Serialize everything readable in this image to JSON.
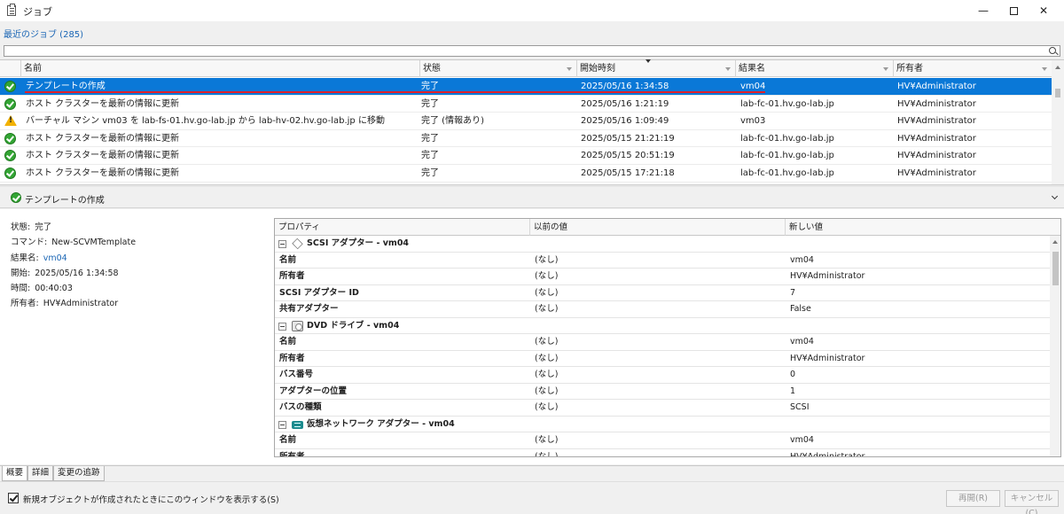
{
  "window": {
    "title": "ジョブ",
    "minimize": "—",
    "close": "✕"
  },
  "jobs_list": {
    "section_title": "最近のジョブ (285)",
    "search_placeholder": "",
    "columns": [
      "名前",
      "状態",
      "開始時刻",
      "結果名",
      "所有者"
    ],
    "rows": [
      {
        "icon": "success",
        "name": "テンプレートの作成",
        "status": "完了",
        "start": "2025/05/16 1:34:58",
        "result": "vm04",
        "owner": "HV¥Administrator"
      },
      {
        "icon": "success",
        "name": "ホスト クラスターを最新の情報に更新",
        "status": "完了",
        "start": "2025/05/16 1:21:19",
        "result": "lab-fc-01.hv.go-lab.jp",
        "owner": "HV¥Administrator"
      },
      {
        "icon": "warning",
        "name": "バーチャル マシン vm03 を lab-fs-01.hv.go-lab.jp から lab-hv-02.hv.go-lab.jp に移動",
        "status": "完了 (情報あり)",
        "start": "2025/05/16 1:09:49",
        "result": "vm03",
        "owner": "HV¥Administrator"
      },
      {
        "icon": "success",
        "name": "ホスト クラスターを最新の情報に更新",
        "status": "完了",
        "start": "2025/05/15 21:21:19",
        "result": "lab-fc-01.hv.go-lab.jp",
        "owner": "HV¥Administrator"
      },
      {
        "icon": "success",
        "name": "ホスト クラスターを最新の情報に更新",
        "status": "完了",
        "start": "2025/05/15 20:51:19",
        "result": "lab-fc-01.hv.go-lab.jp",
        "owner": "HV¥Administrator"
      },
      {
        "icon": "success",
        "name": "ホスト クラスターを最新の情報に更新",
        "status": "完了",
        "start": "2025/05/15 17:21:18",
        "result": "lab-fc-01.hv.go-lab.jp",
        "owner": "HV¥Administrator"
      }
    ]
  },
  "detail": {
    "title": "テンプレートの作成",
    "summary": [
      {
        "label": "状態:",
        "value": "完了",
        "link": false
      },
      {
        "label": "コマンド:",
        "value": "New-SCVMTemplate",
        "link": false
      },
      {
        "label": "結果名:",
        "value": "vm04",
        "link": true
      },
      {
        "label": "開始:",
        "value": "2025/05/16 1:34:58",
        "link": false
      },
      {
        "label": "時間:",
        "value": "00:40:03",
        "link": false
      },
      {
        "label": "所有者:",
        "value": "HV¥Administrator",
        "link": false
      }
    ],
    "properties": {
      "columns": [
        "プロパティ",
        "以前の値",
        "新しい値"
      ],
      "groups": [
        {
          "icon": "scsi-adapter",
          "title": "SCSI アダプター - vm04",
          "rows": [
            {
              "name": "名前",
              "old": "(なし)",
              "new": "vm04"
            },
            {
              "name": "所有者",
              "old": "(なし)",
              "new": "HV¥Administrator"
            },
            {
              "name": "SCSI アダプター ID",
              "old": "(なし)",
              "new": "7"
            },
            {
              "name": "共有アダプター",
              "old": "(なし)",
              "new": "False"
            }
          ]
        },
        {
          "icon": "dvd-drive",
          "title": "DVD ドライブ - vm04",
          "rows": [
            {
              "name": "名前",
              "old": "(なし)",
              "new": "vm04"
            },
            {
              "name": "所有者",
              "old": "(なし)",
              "new": "HV¥Administrator"
            },
            {
              "name": "バス番号",
              "old": "(なし)",
              "new": "0"
            },
            {
              "name": "アダプターの位置",
              "old": "(なし)",
              "new": "1"
            },
            {
              "name": "バスの種類",
              "old": "(なし)",
              "new": "SCSI"
            }
          ]
        },
        {
          "icon": "network-adapter",
          "title": "仮想ネットワーク アダプター - vm04",
          "rows": [
            {
              "name": "名前",
              "old": "(なし)",
              "new": "vm04"
            },
            {
              "name": "所有者",
              "old": "(なし)",
              "new": "HV¥Administrator"
            }
          ]
        }
      ]
    }
  },
  "tabs": [
    "概要",
    "詳細",
    "変更の追跡"
  ],
  "footer": {
    "checkbox_label": "新規オブジェクトが作成されたときにこのウィンドウを表示する(S)",
    "checkbox_checked": true,
    "restart_label": "再開(R)",
    "cancel_label": "キャンセル(C)"
  },
  "colors": {
    "selection": "#0a78d7",
    "accent_text": "#1b66b5",
    "success_icon": "#33a534",
    "warning_icon": "#f2b100",
    "underline_annotation": "#e0202a"
  }
}
